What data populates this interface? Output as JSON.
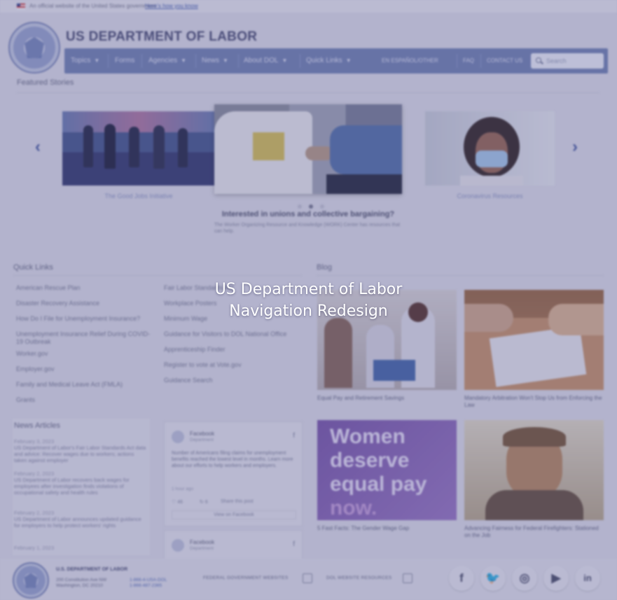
{
  "gov_banner": {
    "text": "An official website of the United States government",
    "link": "Here's how you know"
  },
  "header": {
    "title": "US DEPARTMENT OF LABOR"
  },
  "nav": {
    "items": [
      "Topics",
      "Forms",
      "Agencies",
      "News",
      "About DOL",
      "Quick Links"
    ],
    "right_links": [
      "EN ESPAÑOL/OTHER",
      "FAQ",
      "CONTACT US"
    ],
    "search_placeholder": "Search",
    "search_icon": "search-icon"
  },
  "featured": {
    "heading": "Featured Stories",
    "captions": [
      "The Good Jobs Initiative",
      "Coronavirus Resources"
    ],
    "center_title": "Interested in unions and collective bargaining?",
    "center_sub": "The Worker Organizing Resource and Knowledge (WORK) Center has resources that can help.",
    "prev_icon": "chevron-left-icon",
    "next_icon": "chevron-right-icon"
  },
  "quick_links": {
    "heading": "Quick Links",
    "col1": [
      "American Rescue Plan",
      "Disaster Recovery Assistance",
      "How Do I File for Unemployment Insurance?",
      "Unemployment Insurance Relief During COVID-19 Outbreak",
      "Worker.gov",
      "Employer.gov",
      "Family and Medical Leave Act (FMLA)",
      "Grants"
    ],
    "col2": [
      "Fair Labor Standards Act",
      "Workplace Posters",
      "Minimum Wage",
      "Guidance for Visitors to DOL National Office",
      "Apprenticeship Finder",
      "Register to vote at Vote.gov",
      "Guidance Search"
    ]
  },
  "news": {
    "heading": "News Articles",
    "items": [
      {
        "date": "February 3, 2023",
        "text": "US Department of Labor's Fair Labor Standards Act data and advice: Recover wages due to workers; actions taken against employer"
      },
      {
        "date": "February 2, 2023",
        "text": "US Department of Labor recovers back wages for employees after investigation finds violations of occupational safety and health rules"
      },
      {
        "date": "February 2, 2023",
        "text": "US Department of Labor announces updated guidance for employers to help protect workers' rights"
      },
      {
        "date": "February 1, 2023",
        "text": ""
      }
    ]
  },
  "facebook": {
    "name": "Facebook",
    "sub": "Department",
    "text": "Number of Americans filing claims for unemployment benefits reached the lowest level in months. Learn more about our efforts to help workers and employers.",
    "meta": "1 hour ago",
    "likes": "46",
    "shares": "6",
    "share_label": "Share this post",
    "view_label": "View on Facebook"
  },
  "blog": {
    "heading": "Blog",
    "captions": [
      "Equal Pay and Retirement Savings",
      "Mandatory Arbitration Won't Stop Us from Enforcing the Law",
      "5 Fast Facts: The Gender Wage Gap",
      "Advancing Fairness for Federal Firefighters: Stationed on the Job"
    ],
    "women_lines": [
      "Women",
      "deserve",
      "equal pay",
      "now."
    ]
  },
  "footer": {
    "title": "U.S. DEPARTMENT OF LABOR",
    "address1": "200 Constitution Ave NW",
    "address2": "Washington, DC 20210",
    "phone1": "1-866-4-USA-DOL",
    "phone2": "1-866-487-2365",
    "link1": "FEDERAL GOVERNMENT WEBSITES",
    "link2": "DOL WEBSITE RESOURCES",
    "social": [
      "f",
      "🐦",
      "◎",
      "▶",
      "in"
    ]
  },
  "overlay": {
    "line1": "US Department of Labor",
    "line2": "Navigation Redesign"
  }
}
